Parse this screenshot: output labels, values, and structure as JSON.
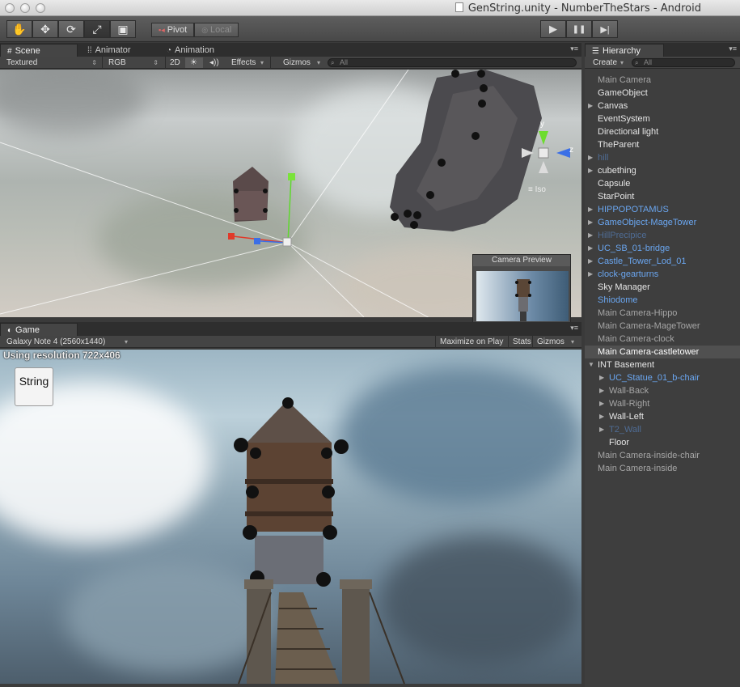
{
  "window": {
    "title": "GenString.unity - NumberTheStars - Android"
  },
  "toolbar": {
    "tools": [
      {
        "name": "hand-tool",
        "glyph": "✋"
      },
      {
        "name": "move-tool",
        "glyph": "✥"
      },
      {
        "name": "rotate-tool",
        "glyph": "⟳"
      },
      {
        "name": "scale-tool",
        "glyph": "⤢"
      },
      {
        "name": "rect-tool",
        "glyph": "▣"
      }
    ],
    "pivot_label": "Pivot",
    "local_label": "Local",
    "play_glyph": "▶",
    "pause_glyph": "❚❚",
    "step_glyph": "▶|"
  },
  "scene_panel": {
    "tabs": [
      {
        "label": "Scene",
        "icon": "#"
      },
      {
        "label": "Animator",
        "icon": "⁞⁞"
      },
      {
        "label": "Animation",
        "icon": "◔"
      }
    ],
    "shading_mode": "Textured",
    "render_mode": "RGB",
    "mode_2d": "2D",
    "light_glyph": "☀",
    "audio_glyph": "◂))",
    "effects_label": "Effects",
    "gizmos_label": "Gizmos",
    "search_placeholder": "All",
    "gizmo_axes": {
      "y": "y",
      "z": "z",
      "iso": "≡ Iso"
    },
    "camera_preview_title": "Camera Preview"
  },
  "game_panel": {
    "tab_label": "Game",
    "tab_icon": "◐",
    "resolution_option": "Galaxy Note 4 (2560x1440)",
    "maximize_label": "Maximize on Play",
    "stats_label": "Stats",
    "gizmos_label": "Gizmos",
    "resolution_text": "Using resolution 722x406",
    "string_button_label": "String"
  },
  "hierarchy": {
    "tab_label": "Hierarchy",
    "tab_icon": "☰",
    "create_label": "Create",
    "search_placeholder": "All",
    "items": [
      {
        "label": "Main Camera",
        "color": "grey",
        "depth": 0,
        "arrow": ""
      },
      {
        "label": "GameObject",
        "color": "white",
        "depth": 0,
        "arrow": ""
      },
      {
        "label": "Canvas",
        "color": "white",
        "depth": 0,
        "arrow": "▶"
      },
      {
        "label": "EventSystem",
        "color": "white",
        "depth": 0,
        "arrow": ""
      },
      {
        "label": "Directional light",
        "color": "white",
        "depth": 0,
        "arrow": ""
      },
      {
        "label": "TheParent",
        "color": "white",
        "depth": 0,
        "arrow": ""
      },
      {
        "label": "hill",
        "color": "dblue",
        "depth": 0,
        "arrow": "▶"
      },
      {
        "label": "cubething",
        "color": "white",
        "depth": 0,
        "arrow": "▶"
      },
      {
        "label": "Capsule",
        "color": "white",
        "depth": 0,
        "arrow": ""
      },
      {
        "label": "StarPoint",
        "color": "white",
        "depth": 0,
        "arrow": ""
      },
      {
        "label": "HIPPOPOTAMUS",
        "color": "blue",
        "depth": 0,
        "arrow": "▶"
      },
      {
        "label": "GameObject-MageTower",
        "color": "blue",
        "depth": 0,
        "arrow": "▶"
      },
      {
        "label": "HillPrecipice",
        "color": "dblue",
        "depth": 0,
        "arrow": "▶"
      },
      {
        "label": "UC_SB_01-bridge",
        "color": "blue",
        "depth": 0,
        "arrow": "▶"
      },
      {
        "label": "Castle_Tower_Lod_01",
        "color": "blue",
        "depth": 0,
        "arrow": "▶"
      },
      {
        "label": "clock-gearturns",
        "color": "blue",
        "depth": 0,
        "arrow": "▶"
      },
      {
        "label": "Sky Manager",
        "color": "white",
        "depth": 0,
        "arrow": ""
      },
      {
        "label": "Shiodome",
        "color": "blue",
        "depth": 0,
        "arrow": ""
      },
      {
        "label": "Main Camera-Hippo",
        "color": "grey",
        "depth": 0,
        "arrow": ""
      },
      {
        "label": "Main Camera-MageTower",
        "color": "grey",
        "depth": 0,
        "arrow": ""
      },
      {
        "label": "Main Camera-clock",
        "color": "grey",
        "depth": 0,
        "arrow": ""
      },
      {
        "label": "Main Camera-castletower",
        "color": "sel",
        "depth": 0,
        "arrow": "",
        "selected": true
      },
      {
        "label": "INT Basement",
        "color": "white",
        "depth": 0,
        "arrow": "▼"
      },
      {
        "label": "UC_Statue_01_b-chair",
        "color": "blue",
        "depth": 1,
        "arrow": "▶"
      },
      {
        "label": "Wall-Back",
        "color": "grey",
        "depth": 1,
        "arrow": "▶"
      },
      {
        "label": "Wall-Right",
        "color": "grey",
        "depth": 1,
        "arrow": "▶"
      },
      {
        "label": "Wall-Left",
        "color": "white",
        "depth": 1,
        "arrow": "▶"
      },
      {
        "label": "T2_Wall",
        "color": "dblue",
        "depth": 1,
        "arrow": "▶"
      },
      {
        "label": "Floor",
        "color": "white",
        "depth": 1,
        "arrow": ""
      },
      {
        "label": "Main Camera-inside-chair",
        "color": "grey",
        "depth": 0,
        "arrow": ""
      },
      {
        "label": "Main Camera-inside",
        "color": "grey",
        "depth": 0,
        "arrow": ""
      }
    ]
  }
}
